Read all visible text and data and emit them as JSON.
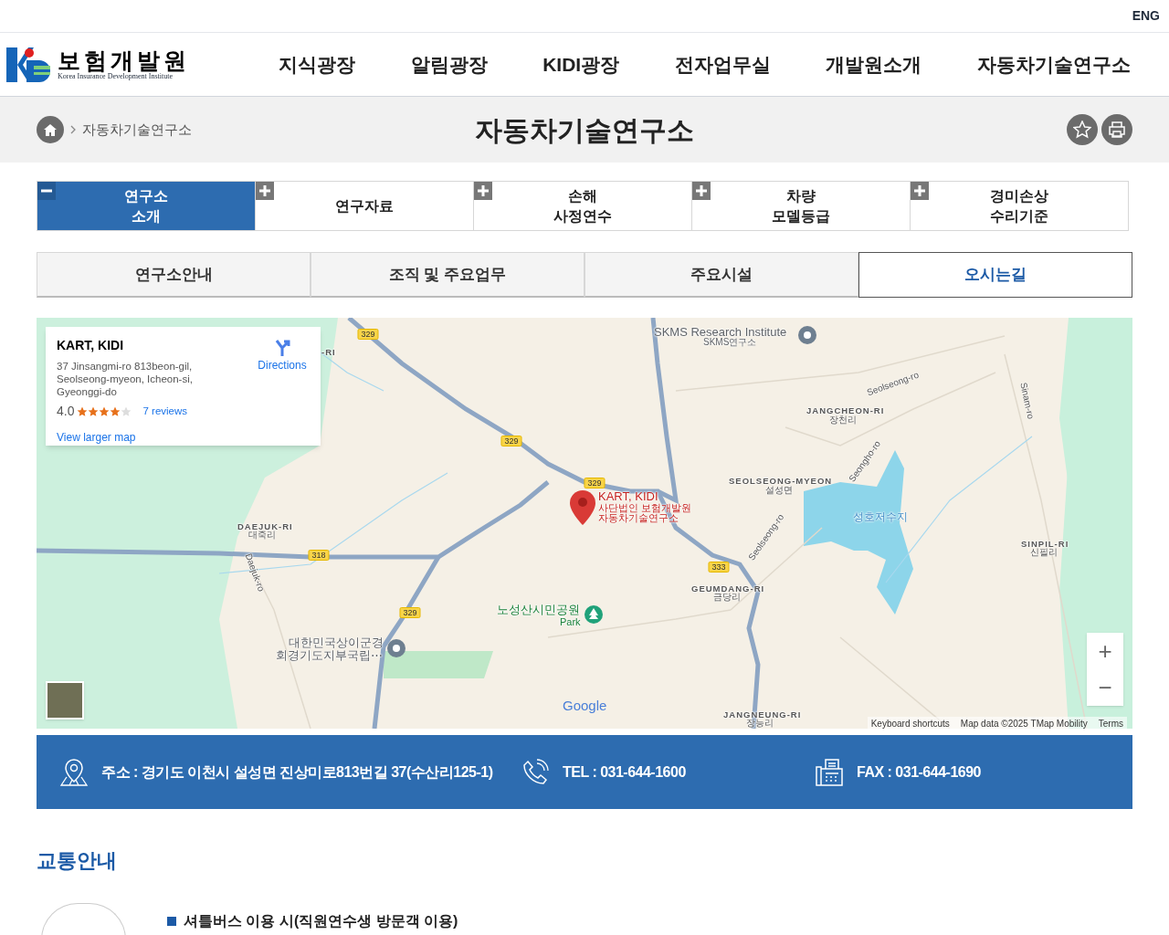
{
  "top_bar": {
    "language_link": "ENG"
  },
  "header": {
    "logo": {
      "name_ko": "보험개발원",
      "name_en": "Korea Insurance Development Institute"
    },
    "nav": [
      "지식광장",
      "알림광장",
      "KIDI광장",
      "전자업무실",
      "개발원소개",
      "자동차기술연구소"
    ]
  },
  "page_header": {
    "breadcrumb": "자동차기술연구소",
    "title": "자동차기술연구소"
  },
  "tabs": [
    {
      "label": "연구소\n소개",
      "selected": true
    },
    {
      "label": "연구자료",
      "selected": false
    },
    {
      "label": "손해\n사정연수",
      "selected": false
    },
    {
      "label": "차량\n모델등급",
      "selected": false
    },
    {
      "label": "경미손상\n수리기준",
      "selected": false
    }
  ],
  "sub_tabs": [
    {
      "label": "연구소안내",
      "selected": false
    },
    {
      "label": "조직 및 주요업무",
      "selected": false
    },
    {
      "label": "주요시설",
      "selected": false
    },
    {
      "label": "오시는길",
      "selected": true
    }
  ],
  "map": {
    "place_card": {
      "name": "KART, KIDI",
      "address": "37 Jinsangmi-ro 813beon-gil, Seolseong-myeon, Icheon-si, Gyeonggi-do",
      "rating": "4.0",
      "stars": 4,
      "reviews": "7 reviews",
      "directions": "Directions",
      "larger_map": "View larger map"
    },
    "labels": [
      {
        "text": "SKMS Research Institute",
        "kind": "poi"
      },
      {
        "text": "SKMS연구소",
        "kind": "poi_sub"
      },
      {
        "text": "-RI",
        "kind": "area"
      },
      {
        "text": "Seolseong-ro",
        "kind": "road"
      },
      {
        "text": "JANGCHEON-RI",
        "kind": "area"
      },
      {
        "text": "장천리",
        "kind": "area_sub"
      },
      {
        "text": "Sinam-ro",
        "kind": "road"
      },
      {
        "text": "SEOLSEONG-MYEON",
        "kind": "area"
      },
      {
        "text": "설성면",
        "kind": "area_sub"
      },
      {
        "text": "Seongho-ro",
        "kind": "road"
      },
      {
        "text": "성호저수지",
        "kind": "water"
      },
      {
        "text": "Seolseong-ro",
        "kind": "road"
      },
      {
        "text": "SINPIL-RI",
        "kind": "area"
      },
      {
        "text": "신필리",
        "kind": "area_sub"
      },
      {
        "text": "GEUMDANG-RI",
        "kind": "area"
      },
      {
        "text": "금당리",
        "kind": "area_sub"
      },
      {
        "text": "KART, KIDI",
        "kind": "target"
      },
      {
        "text": "사단법인 보험개발원",
        "kind": "target_sub"
      },
      {
        "text": "자동차기술연구소",
        "kind": "target_sub"
      },
      {
        "text": "노성산시민공원",
        "kind": "park"
      },
      {
        "text": "Park",
        "kind": "park_sub"
      },
      {
        "text": "DAEJUK-RI",
        "kind": "area"
      },
      {
        "text": "대죽리",
        "kind": "area_sub"
      },
      {
        "text": "Daejuk-ro",
        "kind": "road"
      },
      {
        "text": "대한민국상이군경",
        "kind": "poi"
      },
      {
        "text": "회경기도지부국립⋯",
        "kind": "poi"
      },
      {
        "text": "JANGNEUNG-RI",
        "kind": "area"
      },
      {
        "text": "장능리",
        "kind": "area_sub"
      }
    ],
    "route_shields": [
      "329",
      "329",
      "329",
      "329",
      "318",
      "333"
    ],
    "logo": "Google",
    "zoom_in": "+",
    "zoom_out": "−",
    "footer": [
      "Keyboard shortcuts",
      "Map data ©2025 TMap Mobility",
      "Terms"
    ]
  },
  "contact": [
    {
      "kind": "address",
      "text": "주소 : 경기도 이천시 설성면 진상미로813번길 37(수산리125-1)"
    },
    {
      "kind": "phone",
      "text": "TEL : 031-644-1600"
    },
    {
      "kind": "fax",
      "text": "FAX : 031-644-1690"
    }
  ],
  "section_title": "교통안내",
  "transport": [
    {
      "title": "셔틀버스 이용 시(직원연수생 방문객 이용)"
    }
  ]
}
